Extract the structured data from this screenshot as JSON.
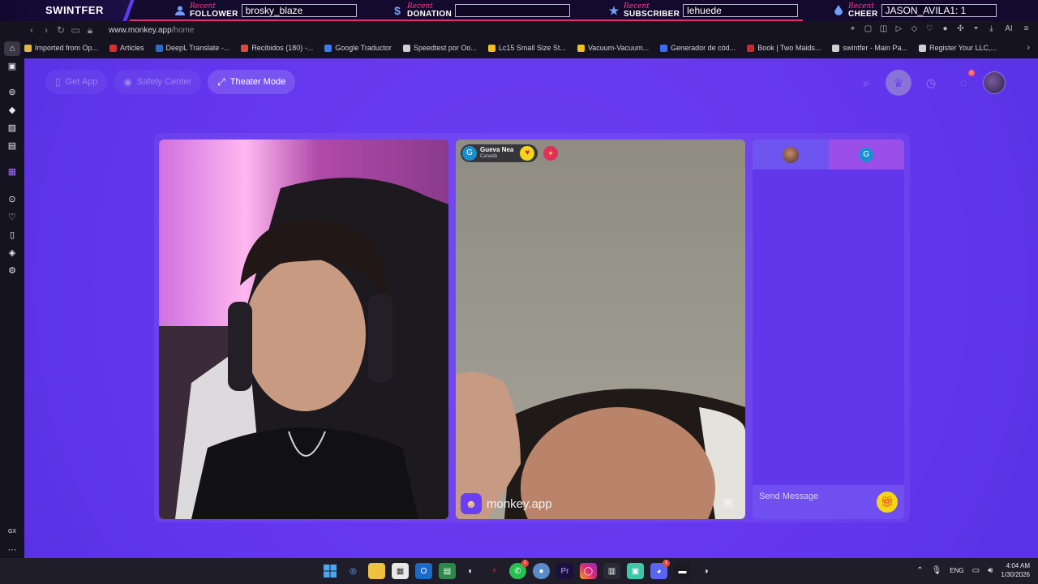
{
  "overlay": {
    "brand": "SWINTFER",
    "items": [
      {
        "recent": "Recent",
        "type": "FOLLOWER",
        "value": "brosky_blaze",
        "icon": "user-icon"
      },
      {
        "recent": "Recent",
        "type": "DONATION",
        "value": "",
        "icon": "dollar-icon"
      },
      {
        "recent": "Recent",
        "type": "SUBSCRIBER",
        "value": "lehuede",
        "icon": "star-icon"
      },
      {
        "recent": "Recent",
        "type": "CHEER",
        "value": "JASON_AVILA1: 1",
        "icon": "gem-icon"
      }
    ],
    "accent": "#e0306f"
  },
  "browser": {
    "url_host": "www.monkey.app",
    "url_path": "/home",
    "ai_label": "AI",
    "bookmarks": [
      {
        "label": "Imported from Op...",
        "color": "#e0b84a"
      },
      {
        "label": "Articles",
        "color": "#d03030"
      },
      {
        "label": "DeepL Translate -...",
        "color": "#2a6cc8"
      },
      {
        "label": "Recibidos (180) -...",
        "color": "#d84a3a"
      },
      {
        "label": "Google Traductor",
        "color": "#3a7de8"
      },
      {
        "label": "Speedtest por Oo...",
        "color": "#cfcfcf"
      },
      {
        "label": "Lc15 Small Size St...",
        "color": "#f0c020"
      },
      {
        "label": "Vacuum-Vacuum...",
        "color": "#f0c020"
      },
      {
        "label": "Generador de cód...",
        "color": "#3a6cf0"
      },
      {
        "label": "Book | Two Maids...",
        "color": "#c82a2a"
      },
      {
        "label": "swintfer - Main Pa...",
        "color": "#cfcfcf"
      },
      {
        "label": "Register Your LLC,...",
        "color": "#cfcfcf"
      }
    ]
  },
  "sidebar": {
    "bottom_label": "GX",
    "more_label": "···"
  },
  "page": {
    "nav": [
      {
        "label": "Get App",
        "icon": "phone-icon"
      },
      {
        "label": "Safety Center",
        "icon": "shield-icon"
      },
      {
        "label": "Theater Mode",
        "icon": "expand-icon"
      }
    ],
    "notifications_badge": "1",
    "match": {
      "avatar_letter": "G",
      "name": "Gueva Nea",
      "country": "Canadá"
    },
    "watermark": "monkey.app",
    "chat": {
      "tab_letter": "G",
      "placeholder": "Send Message"
    }
  },
  "taskbar": {
    "language": "ENG",
    "time": "4:04 AM",
    "date": "1/30/2026",
    "badges": {
      "whatsapp": "1",
      "discord": "1"
    },
    "colors": {
      "purple": "#6437ee"
    }
  }
}
